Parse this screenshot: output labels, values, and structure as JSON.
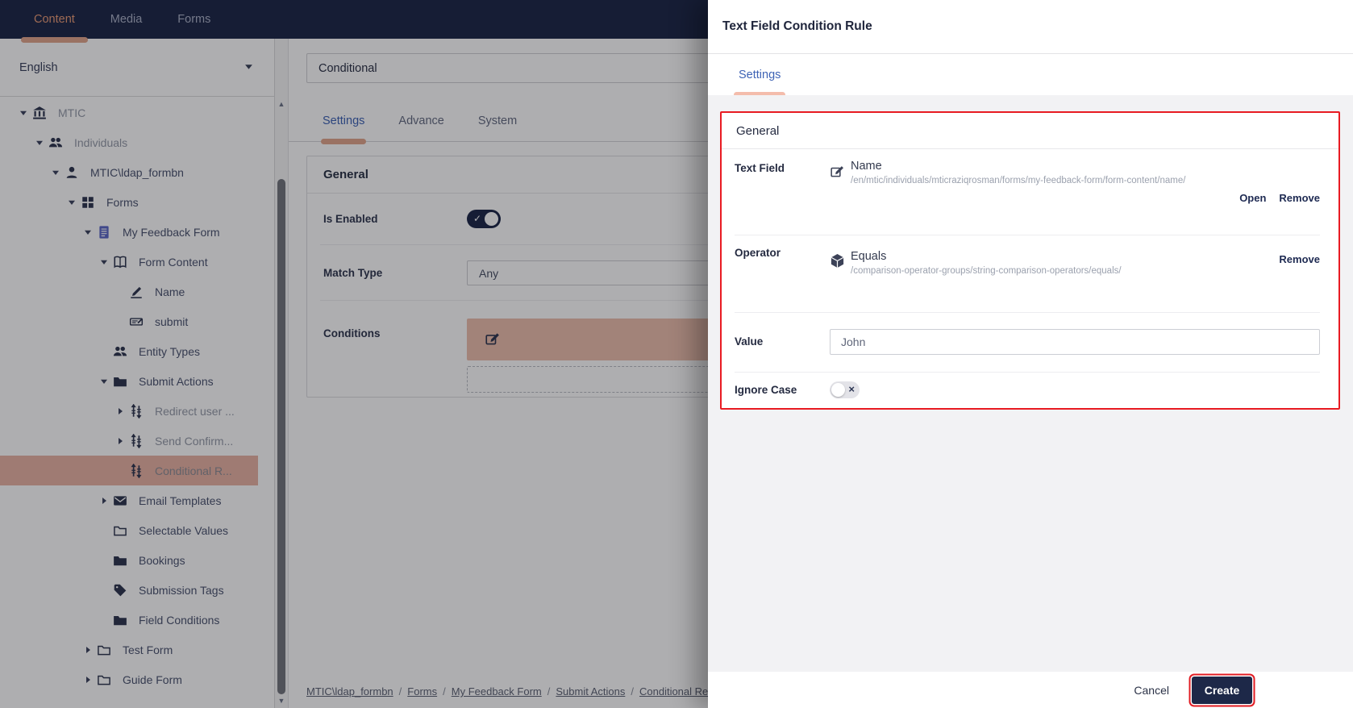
{
  "nav": {
    "tabs": [
      {
        "label": "Content",
        "active": true
      },
      {
        "label": "Media",
        "active": false
      },
      {
        "label": "Forms",
        "active": false
      }
    ]
  },
  "sidebar": {
    "language": {
      "value": "English"
    },
    "tree": [
      {
        "label": "MTIC",
        "level": 0,
        "caret": "down",
        "icon": "bank",
        "muted": true
      },
      {
        "label": "Individuals",
        "level": 1,
        "caret": "down",
        "icon": "users",
        "muted": true
      },
      {
        "label": "MTIC\\ldap_formbn",
        "level": 2,
        "caret": "down",
        "icon": "user"
      },
      {
        "label": "Forms",
        "level": 3,
        "caret": "down",
        "icon": "grid"
      },
      {
        "label": "My Feedback Form",
        "level": 4,
        "caret": "down",
        "icon": "doc",
        "iconColor": "#5b67c7"
      },
      {
        "label": "Form Content",
        "level": 5,
        "caret": "down",
        "icon": "book"
      },
      {
        "label": "Name",
        "level": 6,
        "caret": null,
        "icon": "signature"
      },
      {
        "label": "submit",
        "level": 6,
        "caret": null,
        "icon": "stamp"
      },
      {
        "label": "Entity Types",
        "level": 5,
        "caret": null,
        "icon": "users"
      },
      {
        "label": "Submit Actions",
        "level": 5,
        "caret": "down",
        "icon": "folder"
      },
      {
        "label": "Redirect user ...",
        "level": 6,
        "caret": "right",
        "icon": "sliders",
        "muted": true
      },
      {
        "label": "Send Confirm...",
        "level": 6,
        "caret": "right",
        "icon": "sliders",
        "muted": true
      },
      {
        "label": "Conditional R...",
        "level": 6,
        "caret": null,
        "icon": "sliders",
        "muted": true,
        "selected": true
      },
      {
        "label": "Email Templates",
        "level": 5,
        "caret": "right",
        "icon": "mail"
      },
      {
        "label": "Selectable Values",
        "level": 5,
        "caret": null,
        "icon": "folder-o"
      },
      {
        "label": "Bookings",
        "level": 5,
        "caret": null,
        "icon": "folder"
      },
      {
        "label": "Submission Tags",
        "level": 5,
        "caret": null,
        "icon": "tag"
      },
      {
        "label": "Field Conditions",
        "level": 5,
        "caret": null,
        "icon": "folder"
      },
      {
        "label": "Test Form",
        "level": 4,
        "caret": "right",
        "icon": "folder-o"
      },
      {
        "label": "Guide Form",
        "level": 4,
        "caret": "right",
        "icon": "folder-o"
      }
    ]
  },
  "editor": {
    "title_value": "Conditional",
    "tabs": [
      {
        "label": "Settings",
        "active": true
      },
      {
        "label": "Advance",
        "active": false
      },
      {
        "label": "System",
        "active": false
      }
    ],
    "general": {
      "heading": "General",
      "is_enabled_label": "Is Enabled",
      "is_enabled_value": true,
      "match_type_label": "Match Type",
      "match_type_value": "Any",
      "conditions_label": "Conditions"
    },
    "breadcrumb": [
      "MTIC\\ldap_formbn",
      "Forms",
      "My Feedback Form",
      "Submit Actions",
      "Conditional Rec"
    ]
  },
  "drawer": {
    "title": "Text Field Condition Rule",
    "tabs": [
      {
        "label": "Settings",
        "active": true
      }
    ],
    "card": {
      "heading": "General",
      "text_field": {
        "label": "Text Field",
        "value": "Name",
        "path": "/en/mtic/individuals/mticraziqrosman/forms/my-feedback-form/form-content/name/",
        "actions": [
          "Open",
          "Remove"
        ]
      },
      "operator": {
        "label": "Operator",
        "value": "Equals",
        "path": "/comparison-operator-groups/string-comparison-operators/equals/",
        "actions": [
          "Remove"
        ]
      },
      "value": {
        "label": "Value",
        "input_value": "John"
      },
      "ignore_case": {
        "label": "Ignore Case",
        "enabled": false
      }
    },
    "footer": {
      "cancel_label": "Cancel",
      "create_label": "Create"
    }
  },
  "accents": {
    "navy": "#1d2848",
    "salmon": "#e2a68c",
    "salmon_light": "#f4bcab",
    "tab_blue": "#3e63b5",
    "highlight_red": "#e81b22",
    "selected_row_bg": "#e9b4a4"
  }
}
